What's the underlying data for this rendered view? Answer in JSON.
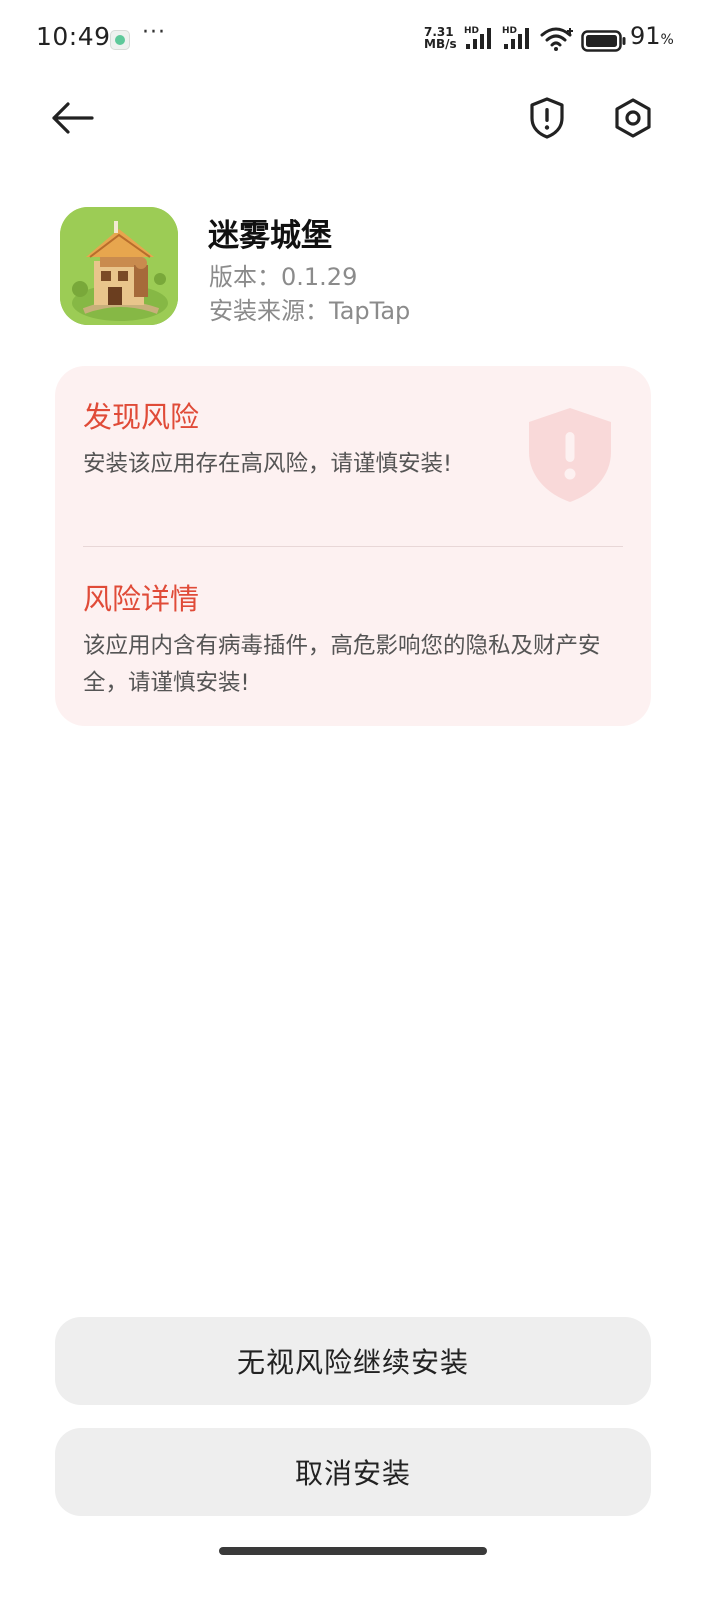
{
  "status_bar": {
    "time": "10:49",
    "more_dots": "···",
    "net_speed_value": "7.31",
    "net_speed_unit": "MB/s",
    "signal_1_label": "HD",
    "signal_2_label": "HD",
    "battery_level": 0.91,
    "battery_percent": "91",
    "battery_percent_sign": "%"
  },
  "app": {
    "name": "迷雾城堡",
    "version_label": "版本：",
    "version": "0.1.29",
    "source_label": "安装来源：",
    "source": "TapTap"
  },
  "risk": {
    "title": "发现风险",
    "description": "安装该应用存在高风险，请谨慎安装!",
    "detail_title": "风险详情",
    "detail_description": "该应用内含有病毒插件，高危影响您的隐私及财产安全，请谨慎安装!"
  },
  "buttons": {
    "continue_label": "无视风险继续安装",
    "cancel_label": "取消安装"
  },
  "icons": {
    "back": "arrow-left-icon",
    "shield": "shield-exclamation-icon",
    "settings": "hexagon-gear-icon"
  },
  "colors": {
    "risk_accent": "#e04b38",
    "risk_card_bg": "#fdf1f1",
    "button_bg": "#eeeeee"
  }
}
